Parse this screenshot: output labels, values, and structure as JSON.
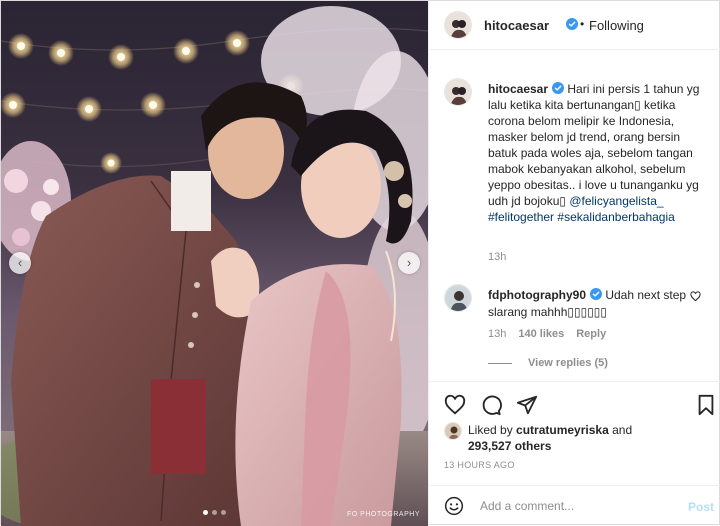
{
  "post": {
    "author": "hitocaesar",
    "follow_status": "Following",
    "bullet": "•"
  },
  "media": {
    "watermark": "FO PHOTOGRAPHY",
    "carousel": {
      "total": 3,
      "active": 1
    },
    "nav_prev": "‹",
    "nav_next": "›"
  },
  "caption": {
    "username": "hitocaesar",
    "text": "Hari ini persis 1 tahun yg lalu ketika kita bertunangan▯ ketika corona belom melipir ke Indonesia, masker belom jd trend, orang bersin batuk pada woles aja, sebelom tangan mabok kebanyakan alkohol, sebelum yeppo obesitas.. i love u tunanganku yg udh jd bojoku▯ ",
    "mention": "@felicyangelista_",
    "hashtag1": "#felitogether",
    "hashtag2": "#sekalidanberbahagia",
    "time": "13h"
  },
  "comment": {
    "username": "fdphotography90",
    "text": "Udah next step slarang mahhh▯▯▯▯▯▯",
    "time": "13h",
    "likes": "140 likes",
    "reply": "Reply",
    "view_replies": "View replies (5)"
  },
  "likes": {
    "prefix": "Liked by",
    "user": "cutratumeyriska",
    "middle": "and",
    "count": "293,527 others"
  },
  "date": "13 HOURS AGO",
  "add_comment": {
    "placeholder": "Add a comment...",
    "post_label": "Post"
  },
  "icons": {
    "verified": "verified-badge-icon",
    "heart": "heart-icon",
    "comment": "comment-icon",
    "share": "share-icon",
    "save": "bookmark-icon",
    "emoji": "emoji-icon"
  },
  "colors": {
    "link": "#00376b",
    "verified": "#3897f0",
    "muted": "#8e8e8e",
    "post_disabled": "#b2dffc"
  }
}
